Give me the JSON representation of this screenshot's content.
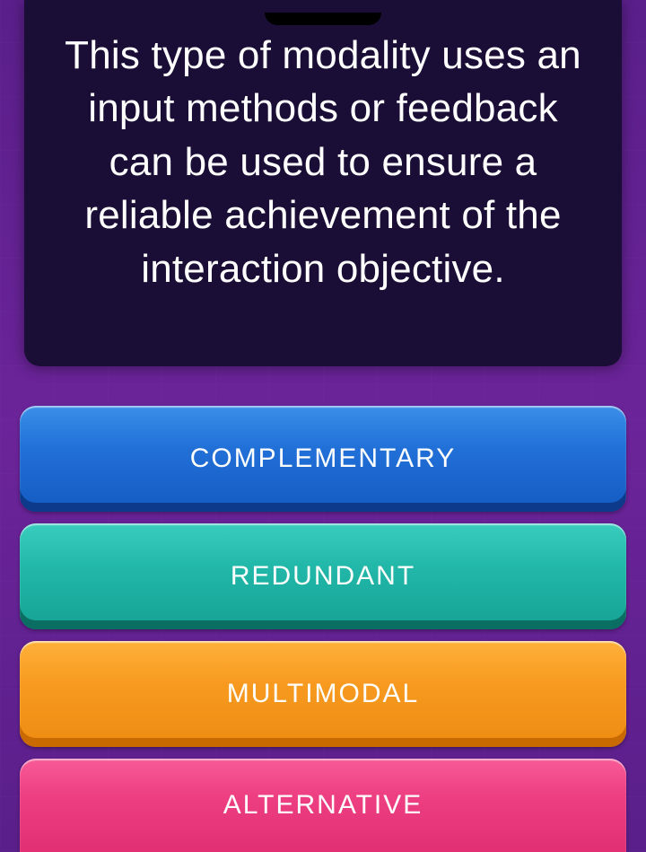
{
  "question": {
    "text": "This type of modality uses an input methods or feedback can be used to ensure a reliable achievement of the interaction objective."
  },
  "answers": [
    {
      "label": "COMPLEMENTARY",
      "color": "blue"
    },
    {
      "label": "REDUNDANT",
      "color": "teal"
    },
    {
      "label": "MULTIMODAL",
      "color": "orange"
    },
    {
      "label": "ALTERNATIVE",
      "color": "pink"
    }
  ]
}
